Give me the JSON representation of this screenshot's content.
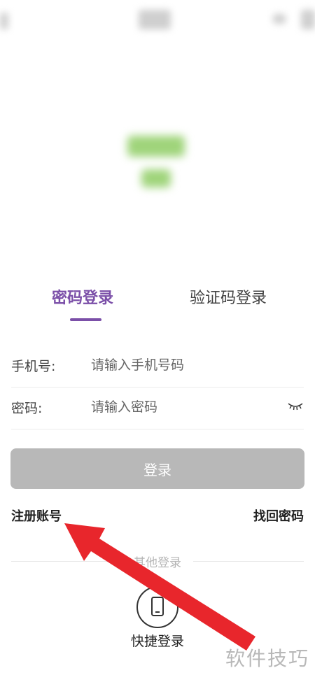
{
  "tabs": [
    {
      "label": "密码登录",
      "active": true
    },
    {
      "label": "验证码登录",
      "active": false
    }
  ],
  "form": {
    "phone": {
      "label": "手机号:",
      "placeholder": "请输入手机号码"
    },
    "password": {
      "label": "密码:",
      "placeholder": "请输入密码"
    }
  },
  "login_button": "登录",
  "links": {
    "register": "注册账号",
    "forgot": "找回密码"
  },
  "other_login": {
    "label": "其他登录",
    "quick_label": "快捷登录"
  },
  "watermark": "软件技巧",
  "colors": {
    "accent": "#7b4fa8",
    "button_disabled": "#b8b8b8",
    "annotation_arrow": "#e8262c"
  },
  "icons": {
    "password_toggle": "eye-closed-icon",
    "quick_login": "phone-icon"
  }
}
